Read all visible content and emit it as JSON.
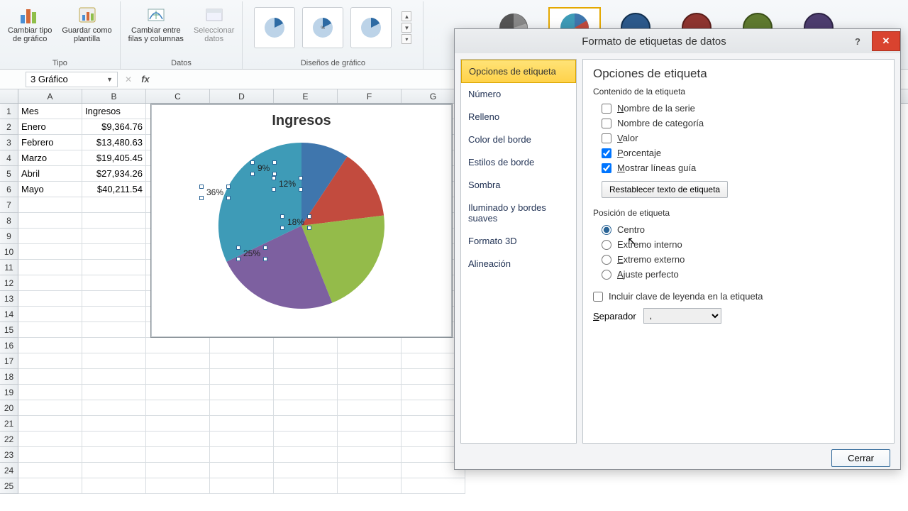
{
  "ribbon": {
    "change_type": "Cambiar tipo\nde gráfico",
    "save_template": "Guardar como\nplantilla",
    "type_group": "Tipo",
    "switch_rc": "Cambiar entre\nfilas y columnas",
    "select_data": "Seleccionar\ndatos",
    "data_group": "Datos",
    "layouts_group": "Diseños de gráfico"
  },
  "formula": {
    "name_box": "3 Gráfico",
    "fx": "fx"
  },
  "sheet": {
    "cols": [
      "A",
      "B",
      "C",
      "D",
      "E",
      "F",
      "G"
    ],
    "headers": {
      "A": "Mes",
      "B": "Ingresos"
    },
    "rows": [
      {
        "A": "Enero",
        "B": "$9,364.76"
      },
      {
        "A": "Febrero",
        "B": "$13,480.63"
      },
      {
        "A": "Marzo",
        "B": "$19,405.45"
      },
      {
        "A": "Abril",
        "B": "$27,934.26"
      },
      {
        "A": "Mayo",
        "B": "$40,211.54"
      }
    ]
  },
  "chart": {
    "title": "Ingresos"
  },
  "chart_data": {
    "type": "pie",
    "title": "Ingresos",
    "categories": [
      "Enero",
      "Febrero",
      "Marzo",
      "Abril",
      "Mayo"
    ],
    "values": [
      9364.76,
      13480.63,
      19405.45,
      27934.26,
      40211.54
    ],
    "percent_labels": [
      "9%",
      "12%",
      "18%",
      "25%",
      "36%"
    ],
    "colors": [
      "#3f76ad",
      "#c24b3e",
      "#94bb4a",
      "#7d60a0",
      "#3e9bb7"
    ]
  },
  "dialog": {
    "title": "Formato de etiquetas de datos",
    "categories": [
      "Opciones de etiqueta",
      "Número",
      "Relleno",
      "Color del borde",
      "Estilos de borde",
      "Sombra",
      "Iluminado y bordes suaves",
      "Formato 3D",
      "Alineación"
    ],
    "panel_title": "Opciones de etiqueta",
    "content_label": "Contenido de la etiqueta",
    "checks": {
      "series": "Nombre de la serie",
      "category": "Nombre de categoría",
      "value": "Valor",
      "percent": "Porcentaje",
      "leader": "Mostrar líneas guía"
    },
    "reset": "Restablecer texto de etiqueta",
    "position_label": "Posición de etiqueta",
    "positions": {
      "center": "Centro",
      "inside": "Extremo interno",
      "outside": "Extremo externo",
      "bestfit": "Ajuste perfecto"
    },
    "legend_key": "Incluir clave de leyenda en la etiqueta",
    "separator_label": "Separador",
    "separator_value": ",",
    "close": "Cerrar"
  }
}
